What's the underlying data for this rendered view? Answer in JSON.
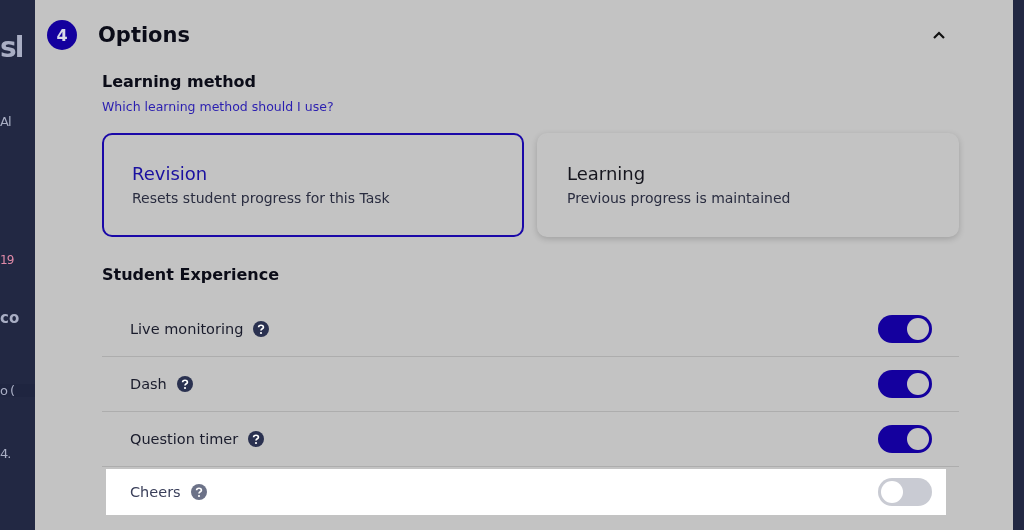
{
  "background_left": [
    {
      "text": "sl",
      "kind": "title"
    },
    {
      "text": "Al",
      "kind": "text"
    },
    {
      "text": "19",
      "kind": "accent"
    },
    {
      "text": "co",
      "kind": "bold"
    },
    {
      "text": "o (",
      "kind": "text"
    },
    {
      "text": "4.",
      "kind": "text"
    }
  ],
  "section": {
    "number": "4",
    "title": "Options",
    "expanded": true
  },
  "learning_method": {
    "heading": "Learning method",
    "help_link": "Which learning method should I use?",
    "options": [
      {
        "title": "Revision",
        "description": "Resets student progress for this Task",
        "selected": true
      },
      {
        "title": "Learning",
        "description": "Previous progress is maintained",
        "selected": false
      }
    ]
  },
  "student_experience": {
    "heading": "Student Experience",
    "settings": [
      {
        "label": "Live monitoring",
        "on": true,
        "highlighted": false
      },
      {
        "label": "Dash",
        "on": true,
        "highlighted": false
      },
      {
        "label": "Question timer",
        "on": true,
        "highlighted": false
      },
      {
        "label": "Cheers",
        "on": false,
        "highlighted": true
      }
    ]
  }
}
